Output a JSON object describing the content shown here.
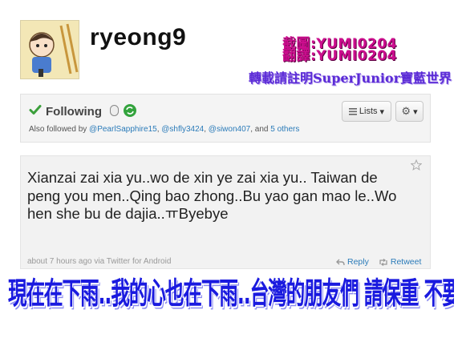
{
  "profile": {
    "username": "ryeong9"
  },
  "overlay": {
    "credit_line_1": "截圖:YUMI0204",
    "credit_line_2": "翻譯:YUMI0204",
    "repost_notice": "轉載請註明SuperJunior寶藍世界",
    "translation": "現在在下雨..我的心也在下雨..台灣的朋友們 請保重 不要感冒"
  },
  "follow": {
    "status_label": "Following",
    "lists_label": "Lists",
    "also_prefix": "Also followed by",
    "followers": [
      "@PearlSapphire15",
      "@shfly3424",
      "@siwon407"
    ],
    "and_label": ", and",
    "others_label": "5 others"
  },
  "tweet": {
    "text": "Xianzai zai xia yu..wo de xin ye zai xia yu.. Taiwan de peng you men..Qing bao zhong..Bu yao gan mao le..Wo hen she bu de dajia..ㅠByebye",
    "time": "about 7 hours ago",
    "via": "via Twitter for Android",
    "reply_label": "Reply",
    "retweet_label": "Retweet"
  },
  "colors": {
    "link": "#2b7bb9",
    "follow_check": "#3b9f3b",
    "credit": "#cc0e8e",
    "repost": "#5b2bd6",
    "translation": "#1a1adf"
  },
  "icons": {
    "check": "check-icon",
    "phone": "phone-icon",
    "retweet_badge": "retweet-badge-icon",
    "gear": "gear-icon",
    "star": "star-icon",
    "reply": "reply-icon",
    "retweet": "retweet-icon"
  }
}
